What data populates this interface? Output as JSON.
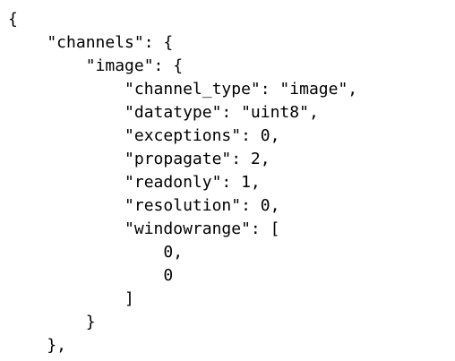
{
  "code": {
    "lines": [
      "{",
      "    \"channels\": {",
      "        \"image\": {",
      "            \"channel_type\": \"image\",",
      "            \"datatype\": \"uint8\",",
      "            \"exceptions\": 0,",
      "            \"propagate\": 2,",
      "            \"readonly\": 1,",
      "            \"resolution\": 0,",
      "            \"windowrange\": [",
      "                0,",
      "                0",
      "            ]",
      "        }",
      "    },"
    ]
  }
}
